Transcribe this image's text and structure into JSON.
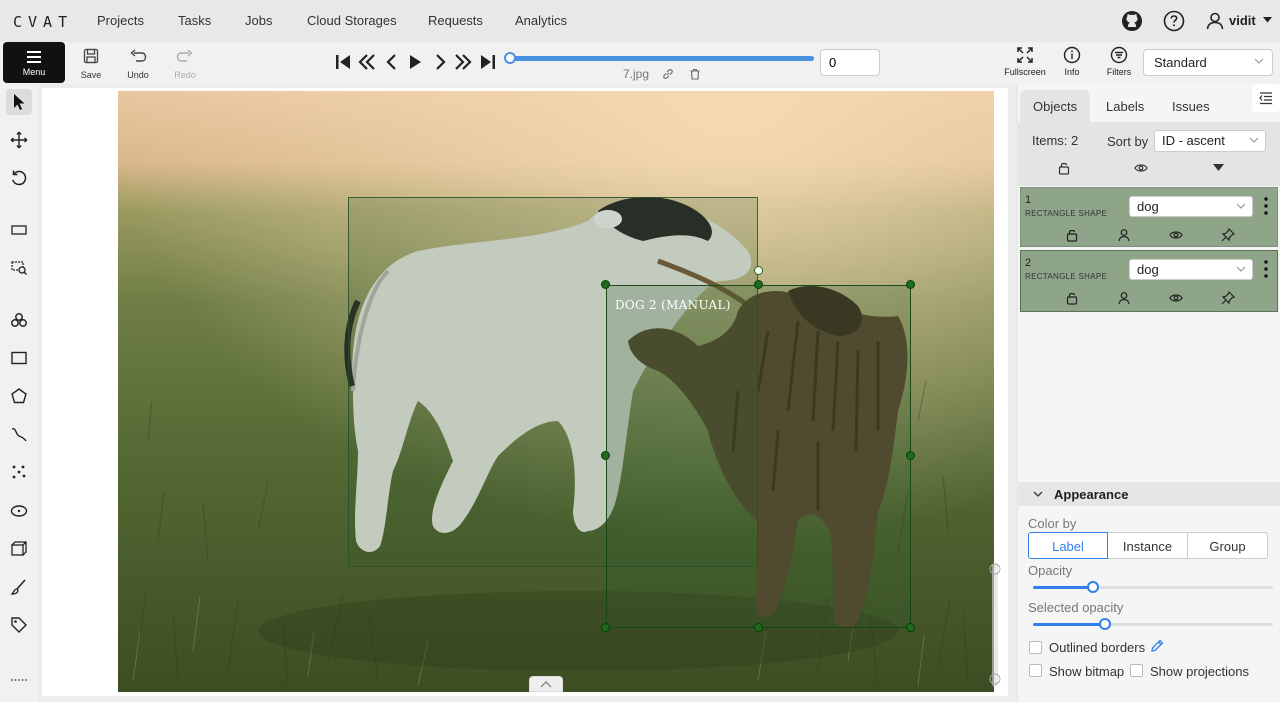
{
  "nav": {
    "logo": "CVAT",
    "links": [
      "Projects",
      "Tasks",
      "Jobs",
      "Cloud Storages",
      "Requests",
      "Analytics"
    ],
    "user": "vidit"
  },
  "toolbar": {
    "menu": "Menu",
    "save": "Save",
    "undo": "Undo",
    "redo": "Redo",
    "frame_number": "0",
    "filename": "7.jpg",
    "frame_progress": 1.0,
    "fullscreen": "Fullscreen",
    "info": "Info",
    "filters": "Filters",
    "workspace": "Standard"
  },
  "canvas": {
    "box_label": "DOG 2 (MANUAL)"
  },
  "sidebar": {
    "tabs": [
      "Objects",
      "Labels",
      "Issues"
    ],
    "items_count": "Items: 2",
    "sort_label": "Sort by",
    "sort_value": "ID - ascent",
    "objects": [
      {
        "id": "1",
        "type": "RECTANGLE SHAPE",
        "label": "dog"
      },
      {
        "id": "2",
        "type": "RECTANGLE SHAPE",
        "label": "dog"
      }
    ]
  },
  "appearance": {
    "title": "Appearance",
    "color_by": "Color by",
    "color_options": [
      "Label",
      "Instance",
      "Group"
    ],
    "selected_color_option": "Label",
    "opacity_label": "Opacity",
    "opacity_value": 0.25,
    "selected_opacity_label": "Selected opacity",
    "selected_opacity_value": 0.3,
    "outlined_borders": "Outlined borders",
    "show_bitmap": "Show bitmap",
    "show_projections": "Show projections"
  },
  "colors": {
    "accent": "#2f80ed",
    "object_card": "#8fa58a",
    "box_stroke": "#1e6b1e"
  }
}
